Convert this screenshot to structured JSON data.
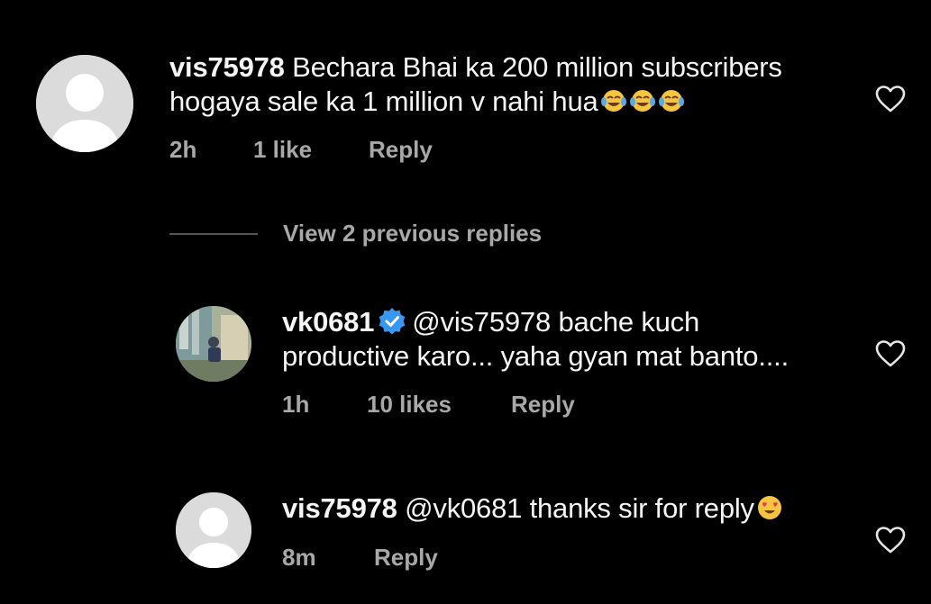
{
  "comments": [
    {
      "username": "vis75978",
      "text_line1": "Bechara Bhai ka 200 million subscribers",
      "text_line2": "hogaya sale ka 1 million v nahi hua",
      "emoji": "😂😂😂",
      "time": "2h",
      "likes": "1 like",
      "reply": "Reply",
      "icons": [
        "avatar-placeholder",
        "heart-outline-icon",
        "tears-of-joy-emoji"
      ]
    }
  ],
  "view_replies": "View 2 previous replies",
  "replies": [
    {
      "username": "vk0681",
      "verified": true,
      "mention": "@vis75978",
      "text_line1": "bache kuch",
      "text_line2": "productive karo... yaha gyan mat banto....",
      "time": "1h",
      "likes": "10 likes",
      "reply": "Reply",
      "icons": [
        "avatar-photo",
        "verified-badge-icon",
        "heart-outline-icon"
      ]
    },
    {
      "username": "vis75978",
      "mention": "@vk0681",
      "text": "thanks sir for reply",
      "emoji": "😍",
      "time": "8m",
      "reply": "Reply",
      "icons": [
        "avatar-placeholder",
        "heart-eyes-emoji",
        "heart-outline-icon"
      ]
    }
  ],
  "colors": {
    "background": "#000000",
    "text": "#f5f5f5",
    "muted": "#a8a8a8",
    "verified": "#3897f0",
    "avatar_placeholder": "#dbdbdb"
  }
}
